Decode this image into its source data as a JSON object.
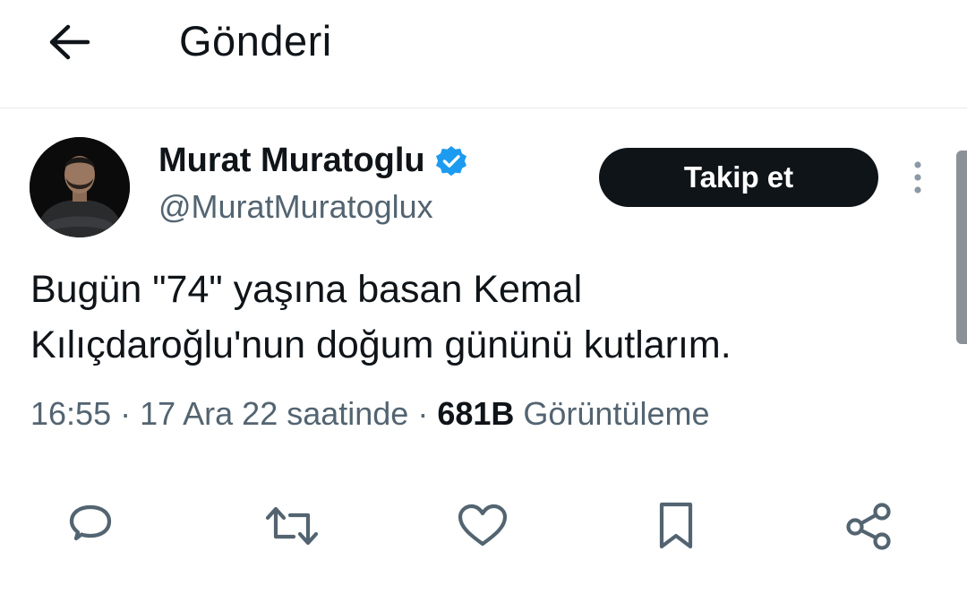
{
  "header": {
    "back_icon": "arrow-left-icon",
    "title": "Gönderi"
  },
  "author": {
    "display_name": "Murat Muratoglu",
    "handle": "@MuratMuratoglux",
    "verified": true,
    "verified_color": "#1d9bf0"
  },
  "follow_button": {
    "label": "Takip et"
  },
  "more_icon": "more-vertical-icon",
  "tweet": {
    "line1": "Bugün \"74\" yaşına basan Kemal",
    "line2": "Kılıçdaroğlu'nun doğum gününü kutlarım."
  },
  "meta": {
    "time": "16:55",
    "sep1": " · ",
    "date": "17 Ara 22 saatinde",
    "sep2": " · ",
    "views_count": "681B",
    "views_label": " Görüntüleme"
  },
  "actions": [
    {
      "name": "reply",
      "icon": "reply-icon"
    },
    {
      "name": "retweet",
      "icon": "retweet-icon"
    },
    {
      "name": "like",
      "icon": "heart-icon"
    },
    {
      "name": "bookmark",
      "icon": "bookmark-icon"
    },
    {
      "name": "share",
      "icon": "share-icon"
    }
  ],
  "colors": {
    "text_primary": "#0f1419",
    "text_secondary": "#536471",
    "action_icon": "#536471",
    "divider": "#e6e9ec"
  }
}
